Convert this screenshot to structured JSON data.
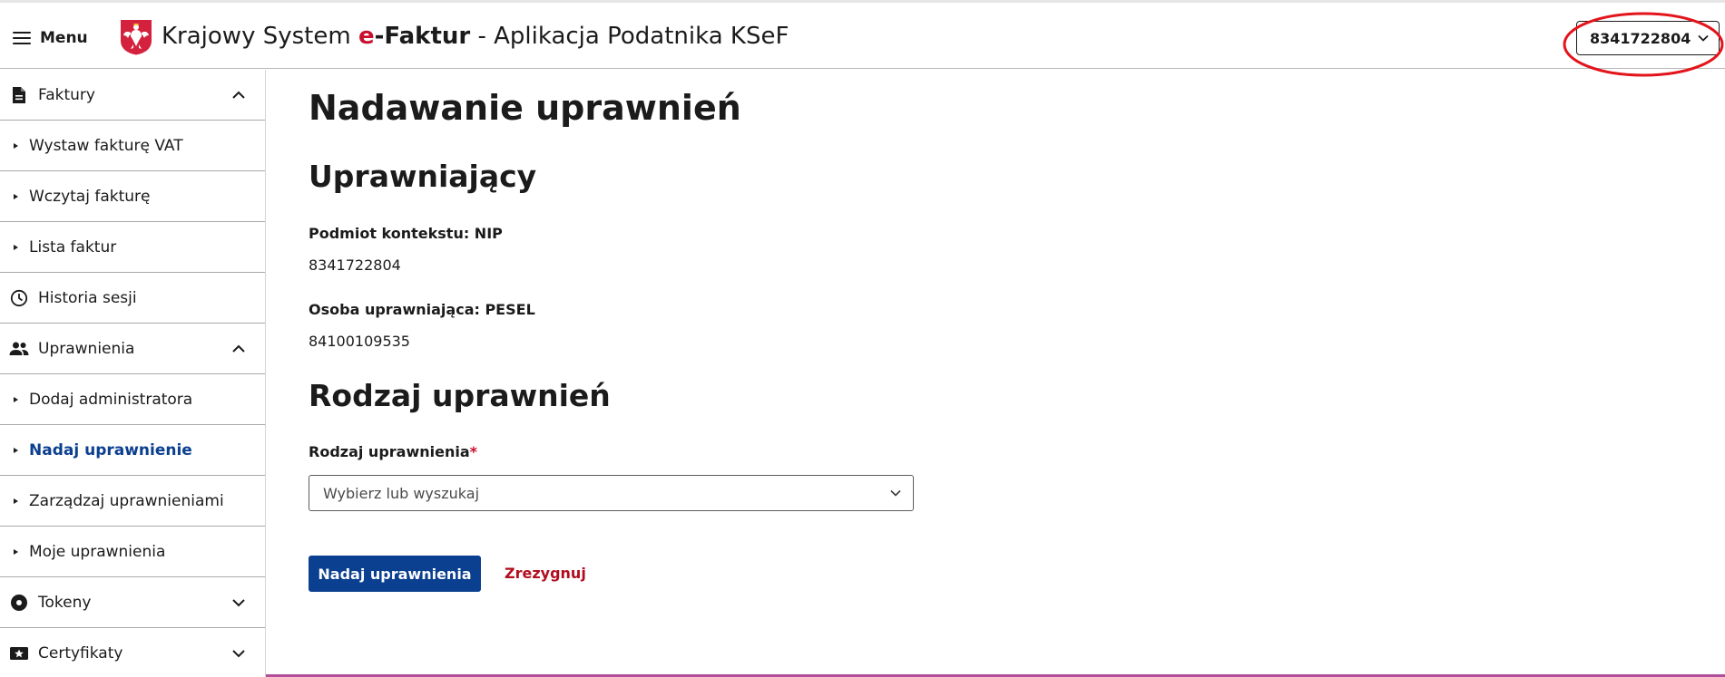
{
  "header": {
    "menu_label": "Menu",
    "app_title_prefix": "Krajowy System ",
    "app_title_e": "e",
    "app_title_faktur": "-Faktur",
    "app_title_suffix": " - Aplikacja Podatnika KSeF",
    "context_nip": "8341722804"
  },
  "sidebar": {
    "items": [
      {
        "label": "Faktury",
        "type": "section",
        "icon": "document-icon",
        "chevron": "up"
      },
      {
        "label": "Wystaw fakturę VAT",
        "type": "sub"
      },
      {
        "label": "Wczytaj fakturę",
        "type": "sub"
      },
      {
        "label": "Lista faktur",
        "type": "sub"
      },
      {
        "label": "Historia sesji",
        "type": "section",
        "icon": "clock-icon"
      },
      {
        "label": "Uprawnienia",
        "type": "section",
        "icon": "people-icon",
        "chevron": "up"
      },
      {
        "label": "Dodaj administratora",
        "type": "sub"
      },
      {
        "label": "Nadaj uprawnienie",
        "type": "sub",
        "active": true
      },
      {
        "label": "Zarządzaj uprawnieniami",
        "type": "sub"
      },
      {
        "label": "Moje uprawnienia",
        "type": "sub"
      },
      {
        "label": "Tokeny",
        "type": "section",
        "icon": "token-icon",
        "chevron": "down"
      },
      {
        "label": "Certyfikaty",
        "type": "section",
        "icon": "certificate-icon",
        "chevron": "down"
      }
    ]
  },
  "main": {
    "page_title": "Nadawanie uprawnień",
    "section_granting": "Uprawniający",
    "context_label": "Podmiot kontekstu: NIP",
    "context_value": "8341722804",
    "person_label": "Osoba uprawniająca: PESEL",
    "person_value": "84100109535",
    "section_type": "Rodzaj uprawnień",
    "type_field_label": "Rodzaj uprawnienia",
    "required_mark": "*",
    "type_field_placeholder": "Wybierz lub wyszukaj",
    "submit_label": "Nadaj uprawnienia",
    "cancel_label": "Zrezygnuj"
  },
  "colors": {
    "primary": "#0b3f8f",
    "accent_red": "#c8102e",
    "cancel_red": "#b20d1e"
  }
}
